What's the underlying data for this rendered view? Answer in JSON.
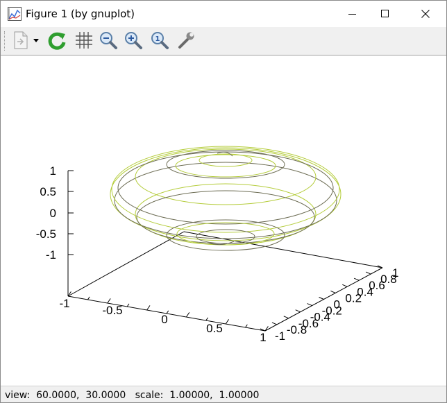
{
  "window": {
    "title": "Figure 1 (by gnuplot)"
  },
  "toolbar": {
    "buttons": [
      {
        "name": "export",
        "icon": "export-document-icon"
      },
      {
        "name": "export-menu",
        "icon": "chevron-down-icon"
      },
      {
        "name": "replot",
        "icon": "refresh-icon"
      },
      {
        "name": "grid",
        "icon": "grid-icon"
      },
      {
        "name": "zoom-previous",
        "icon": "zoom-out-icon"
      },
      {
        "name": "zoom-next",
        "icon": "zoom-in-icon"
      },
      {
        "name": "unzoom",
        "icon": "zoom-reset-icon"
      },
      {
        "name": "options",
        "icon": "wrench-icon"
      }
    ]
  },
  "plot": {
    "z_ticks": [
      "1",
      "0.5",
      "0",
      "-0.5",
      "-1"
    ],
    "x_ticks": [
      "-1",
      "-0.5",
      "0",
      "0.5",
      "1"
    ],
    "y_ticks": [
      "-1",
      "-0.8",
      "-0.6",
      "-0.4",
      "-0.2",
      "0",
      "0.2",
      "0.4",
      "0.6",
      "0.8",
      "1"
    ],
    "colors": {
      "front_curve": "#6b6b52",
      "back_curve": "#b4cc3a"
    }
  },
  "status": {
    "text": "view:  60.0000,  30.0000   scale:  1.00000,  1.00000"
  }
}
